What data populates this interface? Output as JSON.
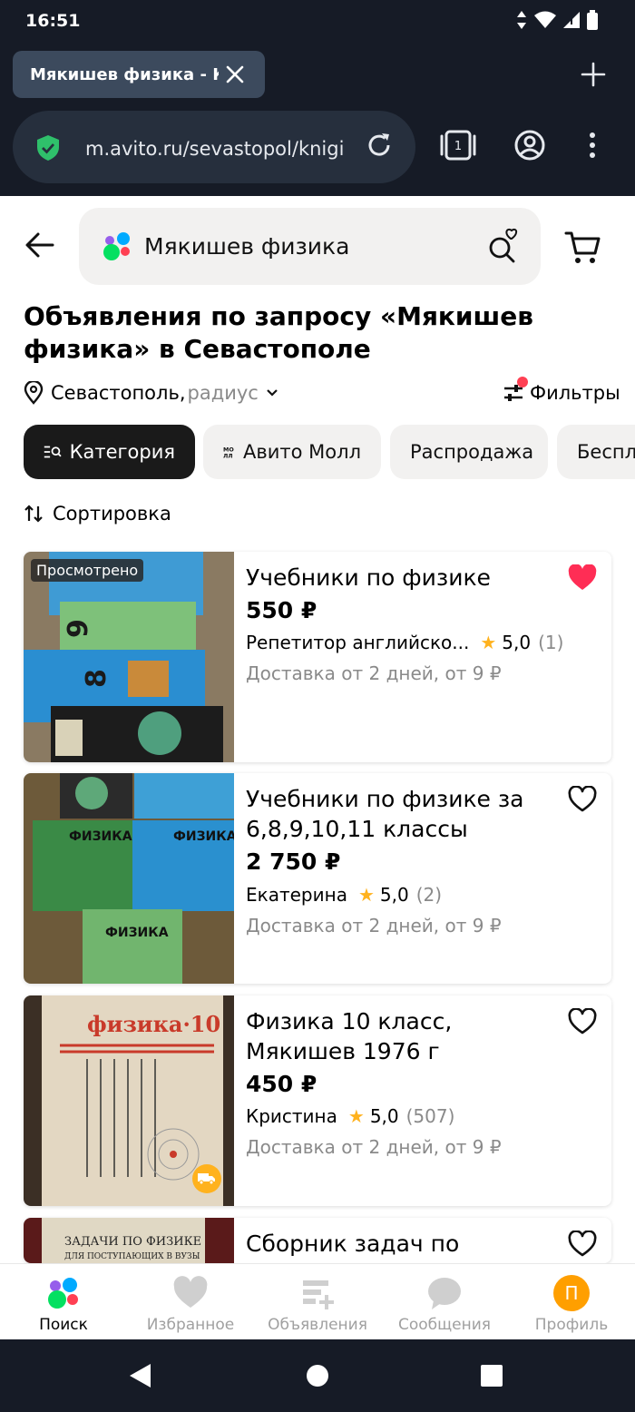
{
  "status_bar": {
    "time": "16:51"
  },
  "browser": {
    "tab_title": "Мякишев физика - Купить",
    "url": "m.avito.ru/sevastopol/knigi",
    "tab_count": "1"
  },
  "search": {
    "query": "Мякишев физика"
  },
  "heading": "Объявления по запросу «Мякишев физика» в Севастополе",
  "location": {
    "city": "Севастополь,",
    "radius": "радиус"
  },
  "filters_label": "Фильтры",
  "chips": [
    "Категория",
    "Авито Молл",
    "Распродажа",
    "Беспл"
  ],
  "sort_label": "Сортировка",
  "listings": [
    {
      "title": "Учебники по физике",
      "price": "550 ₽",
      "seller": "Репетитор английско...",
      "rating": "5,0",
      "reviews": "(1)",
      "delivery": "Доставка от 2 дней, от 9 ₽",
      "badge": "Просмотрено",
      "favorited": true
    },
    {
      "title": "Учебники по физике за 6,8,9,10,11 классы",
      "price": "2 750 ₽",
      "seller": "Екатерина",
      "rating": "5,0",
      "reviews": "(2)",
      "delivery": "Доставка от 2 дней, от 9 ₽",
      "favorited": false
    },
    {
      "title": "Физика 10 класс, Мякишев 1976 г",
      "price": "450 ₽",
      "seller": "Кристина",
      "rating": "5,0",
      "reviews": "(507)",
      "delivery": "Доставка от 2 дней, от 9 ₽",
      "favorited": false
    },
    {
      "title": "Сборник задач по физике,",
      "favorited": false
    }
  ],
  "bottom_nav": {
    "search": "Поиск",
    "favorites": "Избранное",
    "ads": "Объявления",
    "messages": "Сообщения",
    "profile": "Профиль",
    "avatar_letter": "П"
  },
  "colors": {
    "browser_chrome": "#161b26",
    "favorite_red": "#ff2d55",
    "star": "#ffb21e",
    "profile_orange": "#ff9f00"
  }
}
